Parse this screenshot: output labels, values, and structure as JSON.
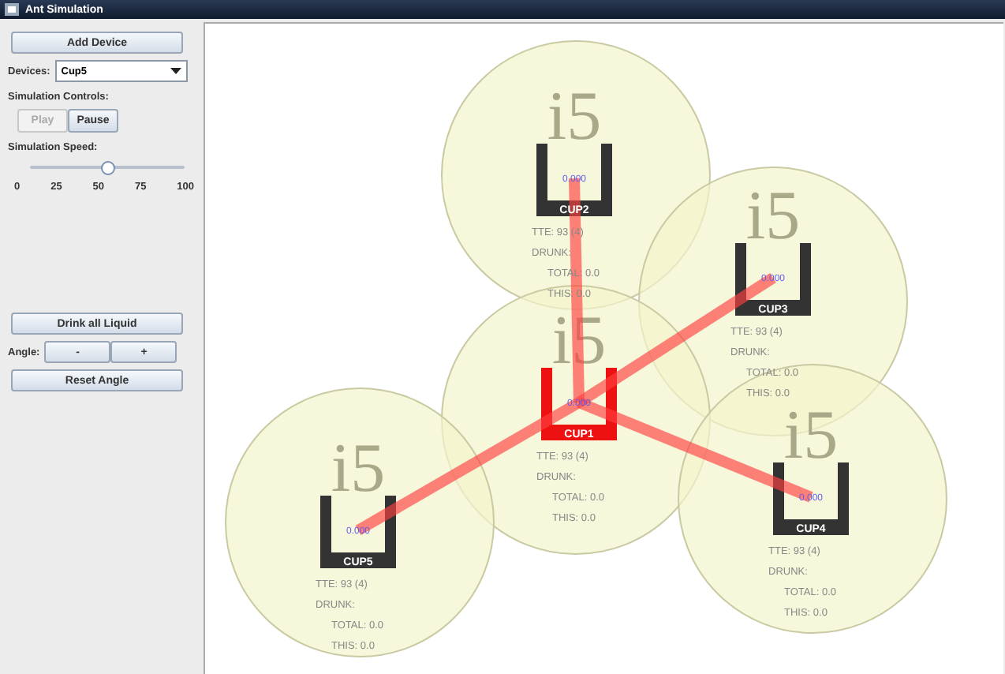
{
  "window": {
    "title": "Ant Simulation"
  },
  "sidebar": {
    "add_button": "Add Device",
    "devices_label": "Devices:",
    "devices_value": "Cup5",
    "controls_label": "Simulation Controls:",
    "controls": [
      {
        "label": "Play",
        "disabled": true
      },
      {
        "label": "Pause",
        "disabled": false
      }
    ],
    "speed_label": "Simulation Speed:",
    "speed": {
      "level": 0.5,
      "ticks": [
        "0",
        "25",
        "50",
        "75",
        "100"
      ]
    },
    "drink_button": "Drink all Liquid",
    "angle_label": "Angle:",
    "angle_buttons": [
      "-",
      "+"
    ],
    "reset_button": "Reset Angle"
  },
  "cups": [
    {
      "name": "CUP2",
      "selected": false,
      "logo": "i5",
      "reading": "0.000",
      "tte": "TTE: 93 (4)",
      "drunk": "DRUNK:",
      "total": "TOTAL: 0.0",
      "this": "THIS: 0.0"
    },
    {
      "name": "CUP3",
      "selected": false,
      "logo": "i5",
      "reading": "0.000",
      "tte": "TTE: 93 (4)",
      "drunk": "DRUNK:",
      "total": "TOTAL: 0.0",
      "this": "THIS: 0.0"
    },
    {
      "name": "CUP1",
      "selected": true,
      "logo": "i5",
      "reading": "0.000",
      "tte": "TTE: 93 (4)",
      "drunk": "DRUNK:",
      "total": "TOTAL: 0.0",
      "this": "THIS: 0.0"
    },
    {
      "name": "CUP4",
      "selected": false,
      "logo": "i5",
      "reading": "0.000",
      "tte": "TTE: 93 (4)",
      "drunk": "DRUNK:",
      "total": "TOTAL: 0.0",
      "this": "THIS: 0.0"
    },
    {
      "name": "CUP5",
      "selected": false,
      "logo": "i5",
      "reading": "0.000",
      "tte": "TTE: 93 (4)",
      "drunk": "DRUNK:",
      "total": "TOTAL: 0.0",
      "this": "THIS: 0.0"
    }
  ]
}
